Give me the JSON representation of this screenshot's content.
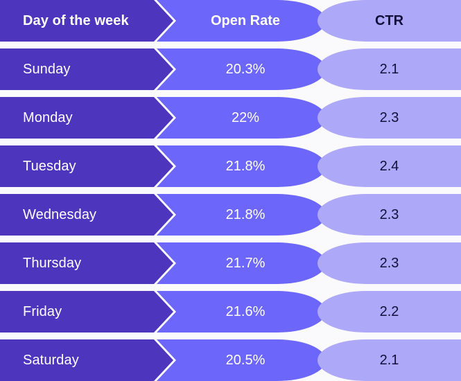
{
  "theme": {
    "background": "#fafafc",
    "col1_bg": "#4e35be",
    "col2_bg": "#6c67fa",
    "col3_bg": "#aea8f8",
    "light_text": "#ffffff",
    "dark_text": "#12103a"
  },
  "table": {
    "headers": {
      "day": "Day of the week",
      "open_rate": "Open Rate",
      "ctr": "CTR"
    },
    "rows": [
      {
        "day": "Sunday",
        "open_rate": "20.3%",
        "ctr": "2.1"
      },
      {
        "day": "Monday",
        "open_rate": "22%",
        "ctr": "2.3"
      },
      {
        "day": "Tuesday",
        "open_rate": "21.8%",
        "ctr": "2.4"
      },
      {
        "day": "Wednesday",
        "open_rate": "21.8%",
        "ctr": "2.3"
      },
      {
        "day": "Thursday",
        "open_rate": "21.7%",
        "ctr": "2.3"
      },
      {
        "day": "Friday",
        "open_rate": "21.6%",
        "ctr": "2.2"
      },
      {
        "day": "Saturday",
        "open_rate": "20.5%",
        "ctr": "2.1"
      }
    ]
  },
  "chart_data": {
    "type": "table",
    "title": "",
    "columns": [
      "Day of the week",
      "Open Rate",
      "CTR"
    ],
    "categories": [
      "Sunday",
      "Monday",
      "Tuesday",
      "Wednesday",
      "Thursday",
      "Friday",
      "Saturday"
    ],
    "series": [
      {
        "name": "Open Rate",
        "unit": "%",
        "values": [
          20.3,
          22,
          21.8,
          21.8,
          21.7,
          21.6,
          20.5
        ]
      },
      {
        "name": "CTR",
        "unit": "%",
        "values": [
          2.1,
          2.3,
          2.4,
          2.3,
          2.3,
          2.2,
          2.1
        ]
      }
    ],
    "xlabel": "Day of the week",
    "ylabel": "",
    "legend": [
      "Open Rate",
      "CTR"
    ]
  }
}
